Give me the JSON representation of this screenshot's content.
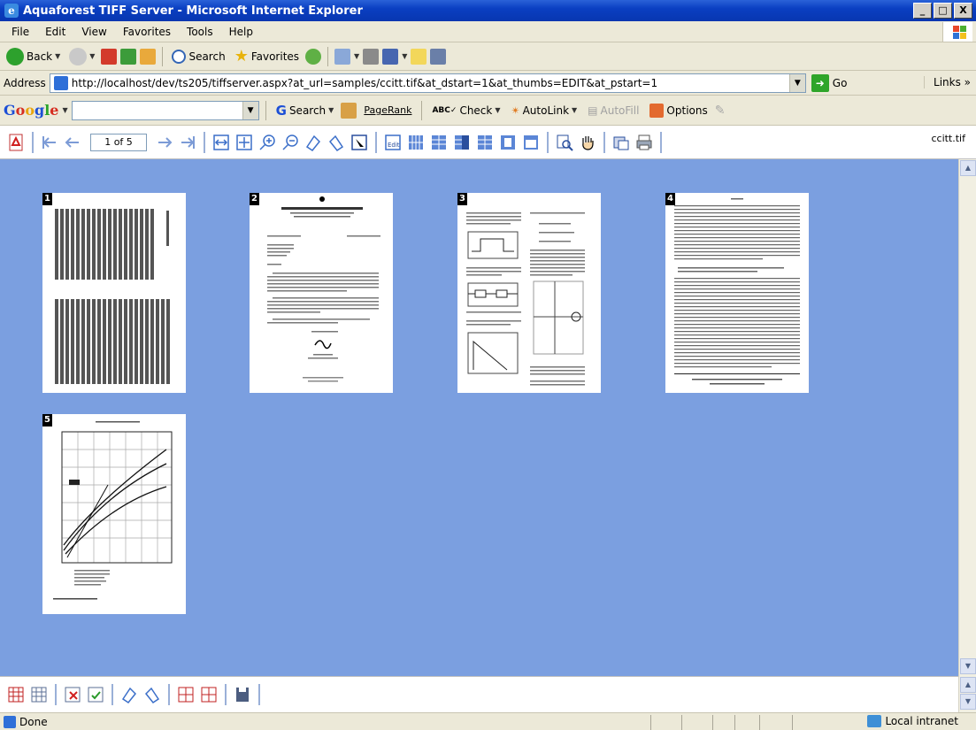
{
  "window": {
    "title": "Aquaforest TIFF Server - Microsoft Internet Explorer",
    "buttons": [
      "_",
      "□",
      "X"
    ]
  },
  "menu": [
    "File",
    "Edit",
    "View",
    "Favorites",
    "Tools",
    "Help"
  ],
  "std_toolbar": {
    "back": "Back",
    "search": "Search",
    "favorites": "Favorites"
  },
  "address": {
    "label": "Address",
    "url": "http://localhost/dev/ts205/tiffserver.aspx?at_url=samples/ccitt.tif&at_dstart=1&at_thumbs=EDIT&at_pstart=1",
    "go": "Go",
    "links": "Links"
  },
  "google_bar": {
    "logo": "Google",
    "search": "Search",
    "pagerank": "PageRank",
    "check": "Check",
    "autolink": "AutoLink",
    "autofill": "AutoFill",
    "options": "Options"
  },
  "viewer": {
    "page_indicator": "1 of 5",
    "filename": "ccitt.tif",
    "thumbnails": [
      {
        "num": "1"
      },
      {
        "num": "2"
      },
      {
        "num": "3"
      },
      {
        "num": "4"
      },
      {
        "num": "5"
      }
    ]
  },
  "status": {
    "text": "Done",
    "zone": "Local intranet"
  }
}
